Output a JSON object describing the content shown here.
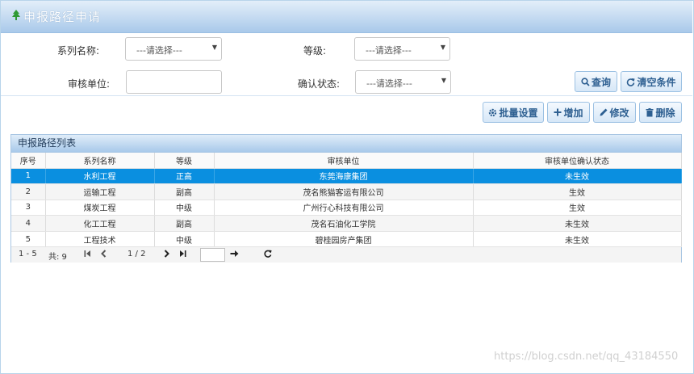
{
  "header": {
    "title": "申报路径申请",
    "icon": "tree-icon",
    "accent": "#2e9a34"
  },
  "form": {
    "series_label": "系列名称:",
    "series_value": "---请选择---",
    "level_label": "等级:",
    "level_value": "---请选择---",
    "unit_label": "审核单位:",
    "unit_value": "",
    "status_label": "确认状态:",
    "status_value": "---请选择---"
  },
  "buttons": {
    "query": "查询",
    "clear": "清空条件",
    "batch": "批量设置",
    "add": "增加",
    "edit": "修改",
    "delete": "删除"
  },
  "table": {
    "title": "申报路径列表",
    "columns": [
      "序号",
      "系列名称",
      "等级",
      "审核单位",
      "审核单位确认状态"
    ],
    "rows": [
      [
        "1",
        "水利工程",
        "正高",
        "东莞海康集团",
        "未生效"
      ],
      [
        "2",
        "运输工程",
        "副高",
        "茂名熊猫客运有限公司",
        "生效"
      ],
      [
        "3",
        "煤炭工程",
        "中级",
        "广州行心科技有限公司",
        "生效"
      ],
      [
        "4",
        "化工工程",
        "副高",
        "茂名石油化工学院",
        "未生效"
      ],
      [
        "5",
        "工程技术",
        "中级",
        "碧桂园房产集团",
        "未生效"
      ]
    ],
    "selected_row": 1,
    "selected_color": "#0a8fe0"
  },
  "pager": {
    "range": "1 - 5",
    "total": "共: 9",
    "page": "1 / 2",
    "page_input": ""
  },
  "watermark": "https://blog.csdn.net/qq_43184550"
}
